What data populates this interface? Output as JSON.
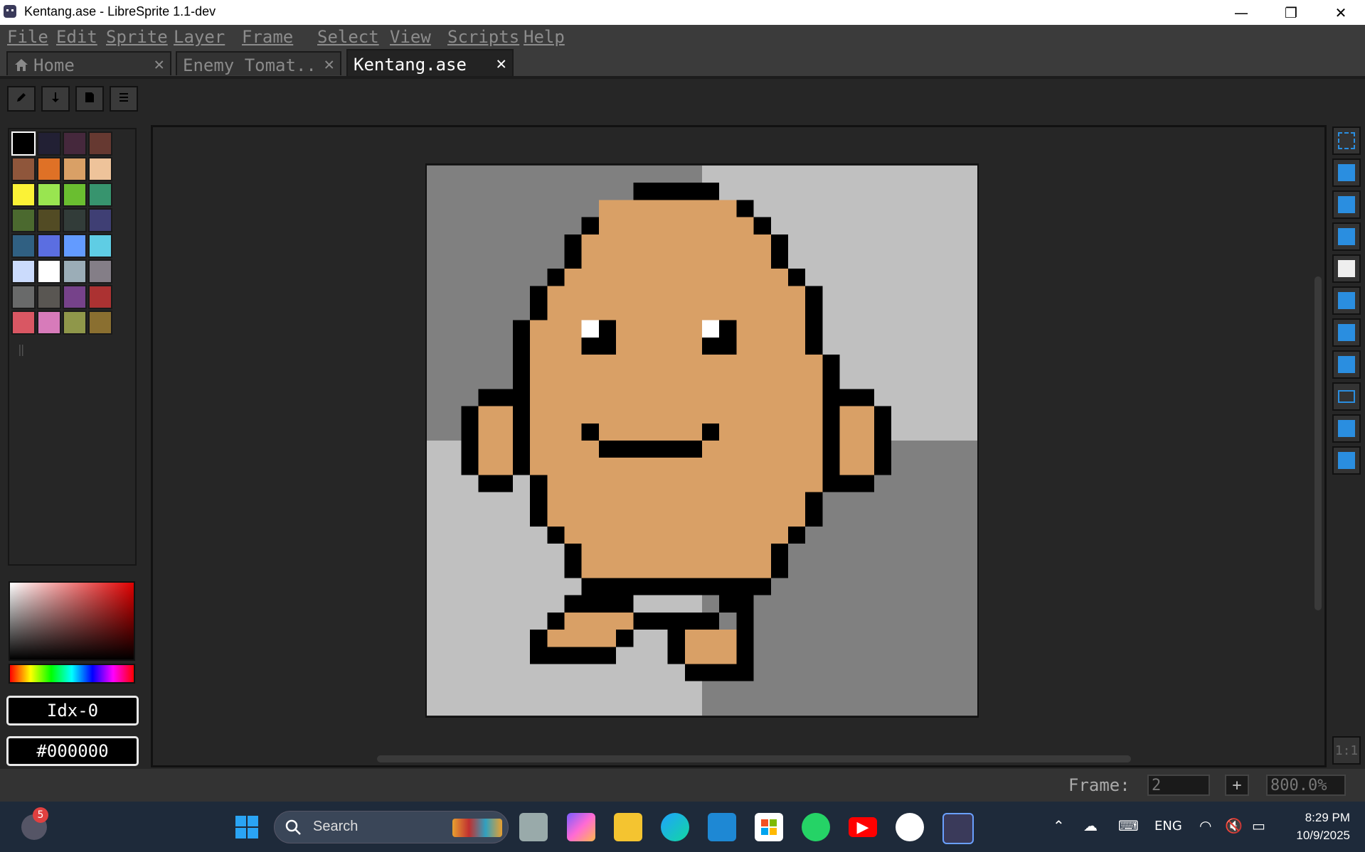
{
  "window": {
    "title": "Kentang.ase - LibreSprite 1.1-dev",
    "minimize": "—",
    "restore": "❐",
    "close": "✕"
  },
  "menu": [
    "File",
    "Edit",
    "Sprite",
    "Layer",
    "Frame",
    "Select",
    "View",
    "Scripts",
    "Help"
  ],
  "tabs": [
    {
      "label": "Home",
      "close": "✕"
    },
    {
      "label": "Enemy Tomat..",
      "close": "✕"
    },
    {
      "label": "Kentang.ase",
      "close": "✕"
    }
  ],
  "palette": [
    "#000000",
    "#222034",
    "#45283c",
    "#663931",
    "#8f563b",
    "#df7126",
    "#d9a066",
    "#eec39a",
    "#fbf236",
    "#99e550",
    "#6abe30",
    "#37946e",
    "#4b692f",
    "#524b24",
    "#323c39",
    "#3f3f74",
    "#306082",
    "#5b6ee1",
    "#639bff",
    "#5fcde4",
    "#cbdbfc",
    "#ffffff",
    "#9badb7",
    "#847e87",
    "#696a6a",
    "#595652",
    "#76428a",
    "#ac3232",
    "#d95763",
    "#d77bba",
    "#8f974a",
    "#8a6f30"
  ],
  "color_index_field": "Idx-0",
  "color_hex_field": "#000000",
  "status": {
    "frame_label": "Frame:",
    "frame_value": "2",
    "add_frame": "+",
    "zoom": "800.0%",
    "one_to_one": "1:1"
  },
  "taskbar": {
    "search_placeholder": "Search",
    "notification_count": "5",
    "language": "ENG",
    "time": "8:29 PM",
    "date": "10/9/2025"
  },
  "sprite_colors": {
    "outline": "#000000",
    "skin": "#d9a066",
    "eye_white": "#ffffff",
    "bg_dark": "#808080",
    "bg_light": "#c0c0c0"
  }
}
